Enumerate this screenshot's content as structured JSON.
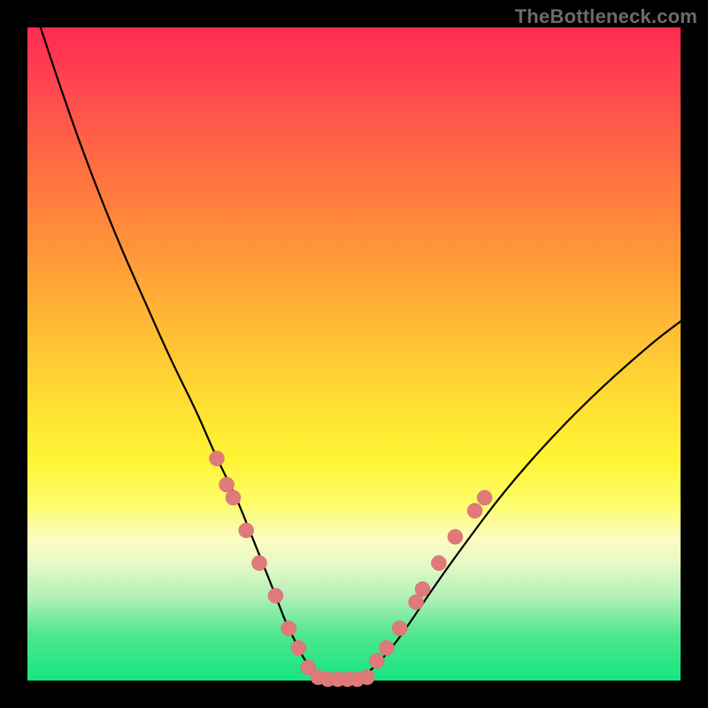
{
  "watermark": "TheBottleneck.com",
  "colors": {
    "frame": "#000000",
    "curve_stroke": "#000000",
    "dot_fill": "#e07a7a",
    "dot_stroke": "#d46a6a"
  },
  "chart_data": {
    "type": "line",
    "title": "",
    "xlabel": "",
    "ylabel": "",
    "xlim": [
      0,
      100
    ],
    "ylim": [
      0,
      100
    ],
    "series": [
      {
        "name": "curve",
        "x": [
          2,
          6,
          10,
          14,
          18,
          22,
          26,
          29,
          32,
          34,
          36,
          38,
          39.5,
          41,
          42.5,
          44,
          46,
          48,
          50,
          52,
          55,
          58,
          62,
          67,
          73,
          80,
          88,
          96,
          100
        ],
        "y": [
          0,
          12,
          23,
          33,
          42,
          51,
          59,
          66,
          72,
          77,
          82,
          87,
          91,
          94,
          97,
          99,
          100,
          100,
          100,
          99,
          96,
          92,
          86,
          79,
          71,
          63,
          55,
          48,
          45
        ]
      }
    ],
    "dots": {
      "left": [
        {
          "x": 29.0,
          "y": 66
        },
        {
          "x": 30.5,
          "y": 70
        },
        {
          "x": 31.5,
          "y": 72
        },
        {
          "x": 33.5,
          "y": 77
        },
        {
          "x": 35.5,
          "y": 82
        },
        {
          "x": 38.0,
          "y": 87
        },
        {
          "x": 40.0,
          "y": 92
        },
        {
          "x": 41.5,
          "y": 95
        },
        {
          "x": 43.0,
          "y": 98
        }
      ],
      "bottom": [
        {
          "x": 44.5,
          "y": 99.5
        },
        {
          "x": 46.0,
          "y": 99.8
        },
        {
          "x": 47.5,
          "y": 99.8
        },
        {
          "x": 49.0,
          "y": 99.8
        },
        {
          "x": 50.5,
          "y": 99.8
        },
        {
          "x": 52.0,
          "y": 99.5
        }
      ],
      "right": [
        {
          "x": 53.5,
          "y": 97
        },
        {
          "x": 55.0,
          "y": 95
        },
        {
          "x": 57.0,
          "y": 92
        },
        {
          "x": 59.5,
          "y": 88
        },
        {
          "x": 60.5,
          "y": 86
        },
        {
          "x": 63.0,
          "y": 82
        },
        {
          "x": 65.5,
          "y": 78
        },
        {
          "x": 68.5,
          "y": 74
        },
        {
          "x": 70.0,
          "y": 72
        }
      ]
    }
  }
}
